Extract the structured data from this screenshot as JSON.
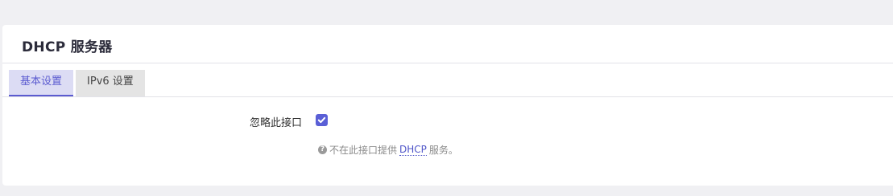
{
  "section": {
    "title": "DHCP 服务器"
  },
  "tabs": [
    {
      "label": "基本设置",
      "active": true
    },
    {
      "label": "IPv6 设置",
      "active": false
    }
  ],
  "form": {
    "ignore_interface": {
      "label": "忽略此接口",
      "checked": true,
      "help_prefix": "不在此接口提供",
      "help_abbr": "DHCP",
      "help_suffix": "服务。"
    }
  },
  "colors": {
    "accent": "#5a5fd6",
    "active_tab_bg": "#dcdcf4",
    "inactive_tab_bg": "#e4e4e4",
    "page_bg": "#f0f0f3"
  },
  "icons": {
    "help": "question-circle-icon",
    "check": "checkmark-icon"
  }
}
